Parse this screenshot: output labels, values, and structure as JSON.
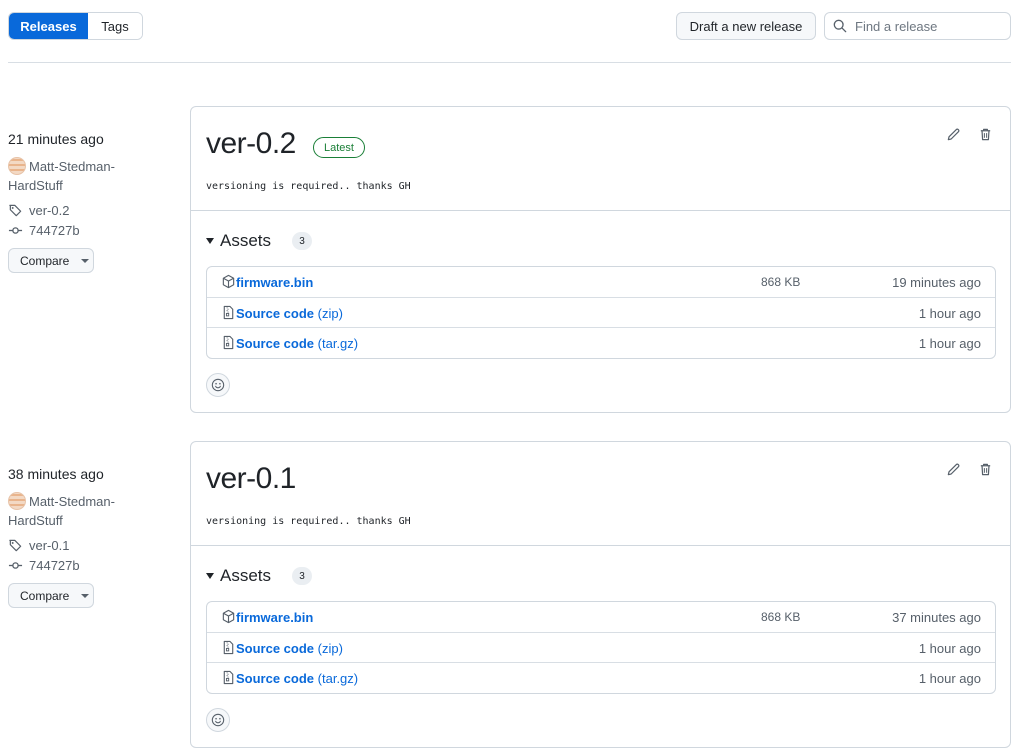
{
  "toolbar": {
    "tab_releases": "Releases",
    "tab_tags": "Tags",
    "draft_label": "Draft a new release",
    "search_placeholder": "Find a release"
  },
  "releases": [
    {
      "time": "21 minutes ago",
      "author": "Matt-Stedman-HardStuff",
      "tag": "ver-0.2",
      "commit": "744727b",
      "compare_label": "Compare",
      "title": "ver-0.2",
      "badge": "Latest",
      "notes": "versioning is required.. thanks GH",
      "assets_label": "Assets",
      "assets_count": "3",
      "assets": [
        {
          "name": "firmware.bin",
          "ext": "",
          "size": "868 KB",
          "time": "19 minutes ago",
          "icon": "package-icon"
        },
        {
          "name": "Source code",
          "ext": "(zip)",
          "size": "",
          "time": "1 hour ago",
          "icon": "file-zip-icon"
        },
        {
          "name": "Source code",
          "ext": "(tar.gz)",
          "size": "",
          "time": "1 hour ago",
          "icon": "file-zip-icon"
        }
      ]
    },
    {
      "time": "38 minutes ago",
      "author": "Matt-Stedman-HardStuff",
      "tag": "ver-0.1",
      "commit": "744727b",
      "compare_label": "Compare",
      "title": "ver-0.1",
      "badge": "",
      "notes": "versioning is required.. thanks GH",
      "assets_label": "Assets",
      "assets_count": "3",
      "assets": [
        {
          "name": "firmware.bin",
          "ext": "",
          "size": "868 KB",
          "time": "37 minutes ago",
          "icon": "package-icon"
        },
        {
          "name": "Source code",
          "ext": "(zip)",
          "size": "",
          "time": "1 hour ago",
          "icon": "file-zip-icon"
        },
        {
          "name": "Source code",
          "ext": "(tar.gz)",
          "size": "",
          "time": "1 hour ago",
          "icon": "file-zip-icon"
        }
      ]
    }
  ],
  "colors": {
    "accent": "#0969da",
    "latest_badge": "#1a7f37",
    "border": "#d0d7de",
    "muted_text": "#57606a"
  }
}
